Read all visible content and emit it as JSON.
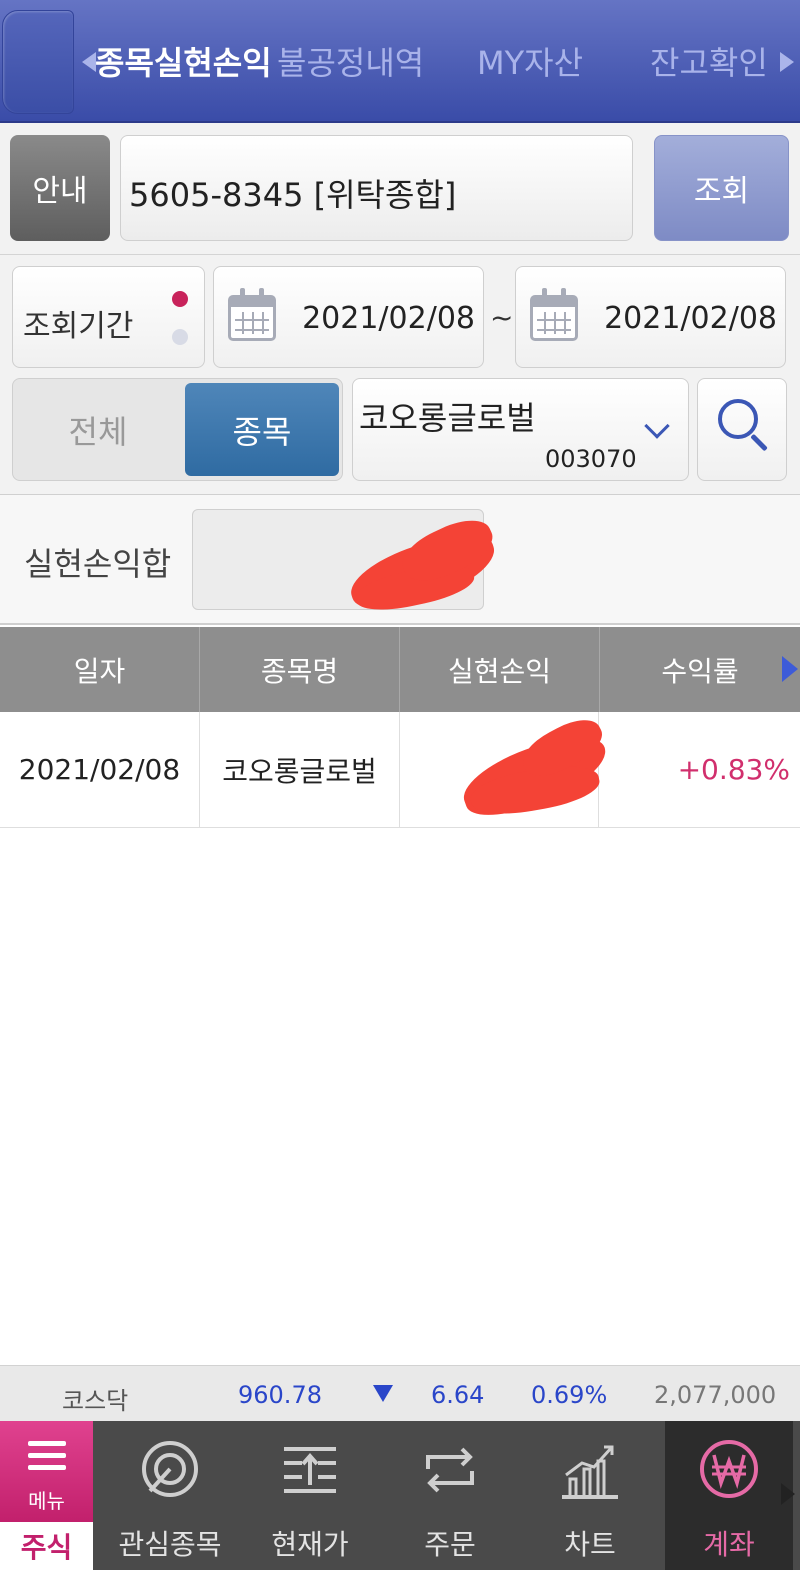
{
  "tabs": [
    "종목실현손익",
    "불공정내역",
    "MY자산",
    "잔고확인"
  ],
  "account": {
    "info_label": "안내",
    "number": "5605-8345 [위탁종합]",
    "query_label": "조회"
  },
  "period": {
    "label": "조회기간",
    "start": "2021/02/08",
    "separator": "~",
    "end": "2021/02/08"
  },
  "filter": {
    "all_label": "전체",
    "item_label": "종목",
    "stock_name": "코오롱글로벌",
    "stock_code": "003070"
  },
  "summary": {
    "label": "실현손익합"
  },
  "table": {
    "headers": [
      "일자",
      "종목명",
      "실현손익",
      "수익률"
    ],
    "rows": [
      {
        "date": "2021/02/08",
        "name": "코오롱글로벌",
        "pnl": "",
        "rate": "+0.83%"
      }
    ]
  },
  "ticker": {
    "name": "코스닥",
    "value": "960.78",
    "change": "6.64",
    "percent": "0.69%",
    "volume": "2,077,000"
  },
  "bottom_nav": {
    "menu_label": "메뉴",
    "stock_tab": "주식",
    "items": [
      "관심종목",
      "현재가",
      "주문",
      "차트",
      "계좌"
    ],
    "icons": [
      "target-icon",
      "price-icon",
      "order-icon",
      "chart-icon",
      "won-icon"
    ]
  },
  "colors": {
    "header_blue": "#3a4ca8",
    "accent_pink": "#c2206c",
    "positive": "#d12f6d",
    "down_blue": "#2a46c9",
    "segment_active": "#2f6ba2"
  }
}
